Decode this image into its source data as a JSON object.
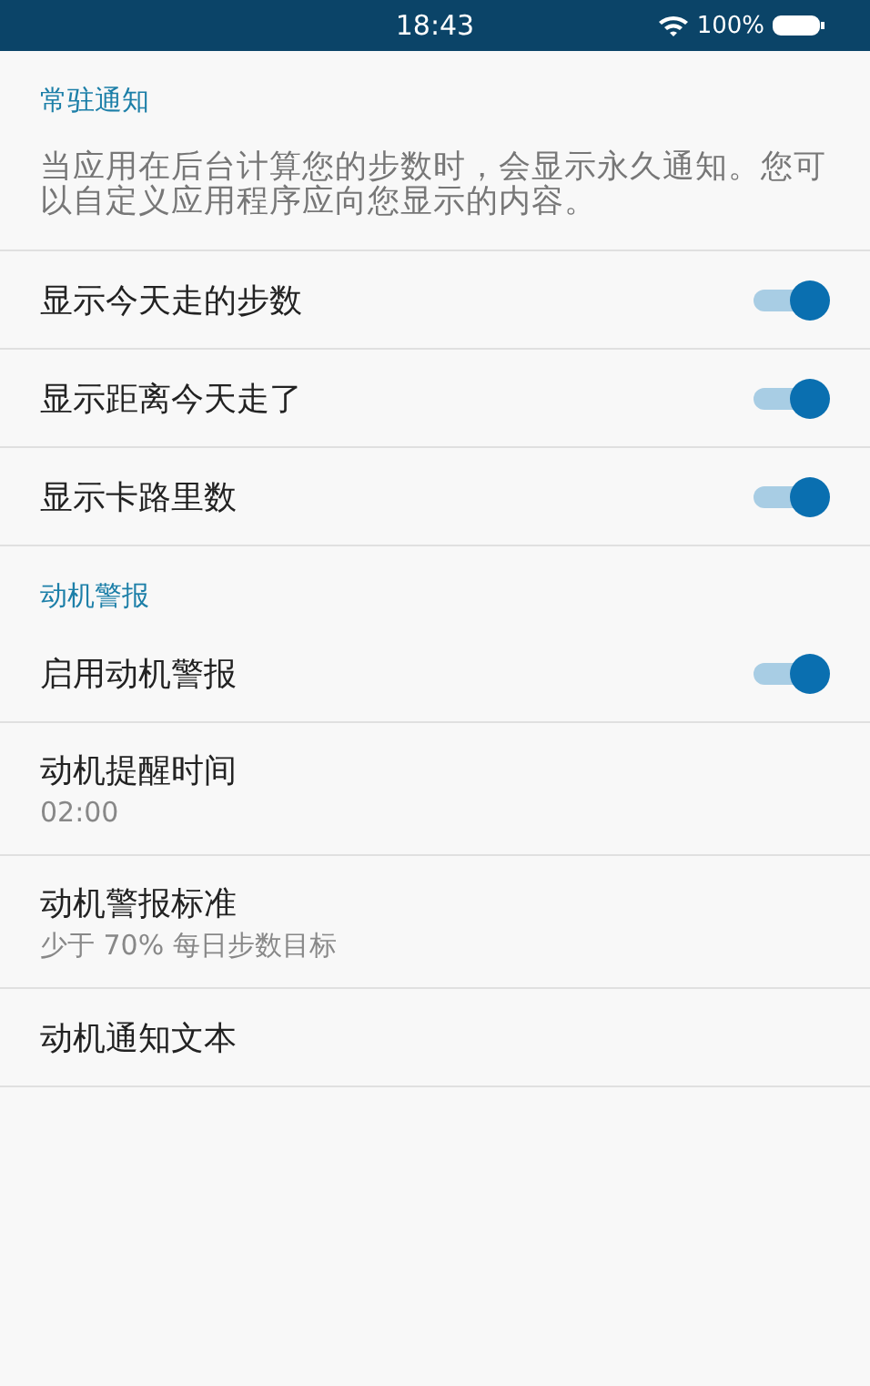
{
  "status_bar": {
    "time": "18:43",
    "battery": "100%"
  },
  "sections": [
    {
      "title": "常驻通知",
      "description": "当应用在后台计算您的步数时，会显示永久通知。您可以自定义应用程序应向您显示的内容。",
      "items": [
        {
          "kind": "switch",
          "label": "显示今天走的步数",
          "on": true
        },
        {
          "kind": "switch",
          "label": "显示距离今天走了",
          "on": true
        },
        {
          "kind": "switch",
          "label": "显示卡路里数",
          "on": true
        }
      ]
    },
    {
      "title": "动机警报",
      "items": [
        {
          "kind": "switch",
          "label": "启用动机警报",
          "on": true
        },
        {
          "kind": "text",
          "label": "动机提醒时间",
          "summary": "02:00"
        },
        {
          "kind": "text",
          "label": "动机警报标准",
          "summary": "少于 70% 每日步数目标"
        },
        {
          "kind": "text",
          "label": "动机通知文本"
        }
      ]
    }
  ]
}
